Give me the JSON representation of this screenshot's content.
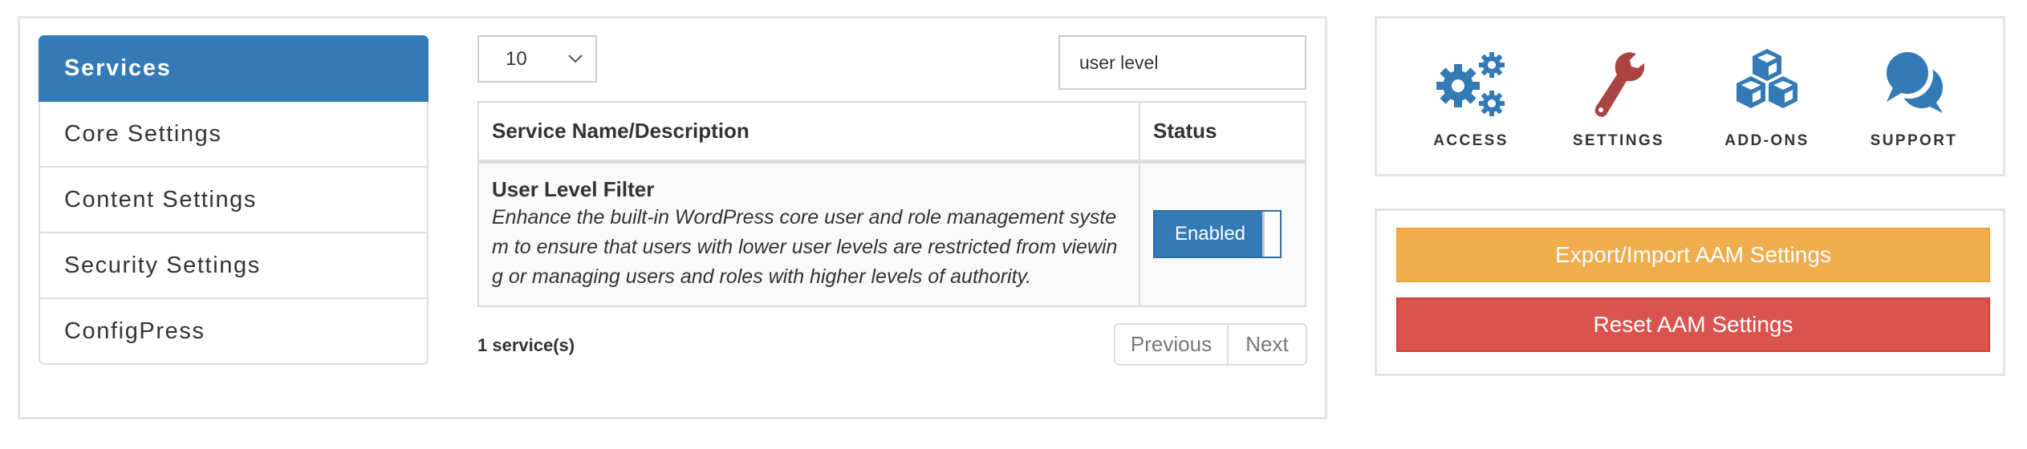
{
  "sidebar": {
    "items": [
      {
        "label": "Services",
        "active": true
      },
      {
        "label": "Core Settings"
      },
      {
        "label": "Content Settings"
      },
      {
        "label": "Security Settings"
      },
      {
        "label": "ConfigPress"
      }
    ]
  },
  "table_controls": {
    "page_length": "10",
    "search_value": "user level"
  },
  "table": {
    "columns": [
      "Service Name/Description",
      "Status"
    ],
    "rows": [
      {
        "title": "User Level Filter",
        "description": "Enhance the built-in WordPress core user and role management system to ensure that users with lower user levels are restricted from viewing or managing users and roles with higher levels of authority.",
        "status": "Enabled"
      }
    ]
  },
  "footer": {
    "count": "1 service(s)",
    "previous": "Previous",
    "next": "Next"
  },
  "nav": {
    "tiles": [
      {
        "label": "ACCESS",
        "icon": "cogs-icon",
        "color": "#337ab7"
      },
      {
        "label": "SETTINGS",
        "icon": "wrench-icon",
        "color": "#a94442"
      },
      {
        "label": "ADD-ONS",
        "icon": "cubes-icon",
        "color": "#337ab7"
      },
      {
        "label": "SUPPORT",
        "icon": "comments-icon",
        "color": "#337ab7"
      }
    ]
  },
  "actions": {
    "export_label": "Export/Import AAM Settings",
    "reset_label": "Reset AAM Settings",
    "export_color": "#f0ad4e",
    "reset_color": "#d9534f"
  },
  "colors": {
    "primary": "#337ab7",
    "danger_icon": "#a94442"
  }
}
